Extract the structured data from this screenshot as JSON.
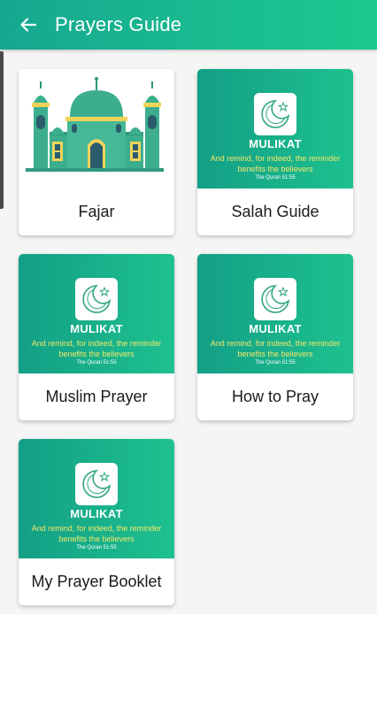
{
  "header": {
    "title": "Prayers Guide",
    "back_icon": "arrow-left-icon"
  },
  "colors": {
    "header_start": "#16a890",
    "header_end": "#1cc98f",
    "tagline": "#f2e86a"
  },
  "cards": [
    {
      "label": "Fajar",
      "image": "mosque-illustration"
    },
    {
      "label": "Salah Guide",
      "image": "mulikat-logo",
      "brand": "MULIKAT",
      "tagline": "And remind, for indeed, the reminder benefits the believers",
      "source": "The Quran 51:55"
    },
    {
      "label": "Muslim Prayer",
      "image": "mulikat-logo",
      "brand": "MULIKAT",
      "tagline": "And remind, for indeed, the reminder benefits the believers",
      "source": "The Quran 51:55"
    },
    {
      "label": "How to Pray",
      "image": "mulikat-logo",
      "brand": "MULIKAT",
      "tagline": "And remind, for indeed, the reminder benefits the believers",
      "source": "The Quran 51:55"
    },
    {
      "label": "My Prayer Booklet",
      "image": "mulikat-logo",
      "brand": "MULIKAT",
      "tagline": "And remind, for indeed, the reminder benefits the believers",
      "source": "The Quran 51:55"
    }
  ]
}
